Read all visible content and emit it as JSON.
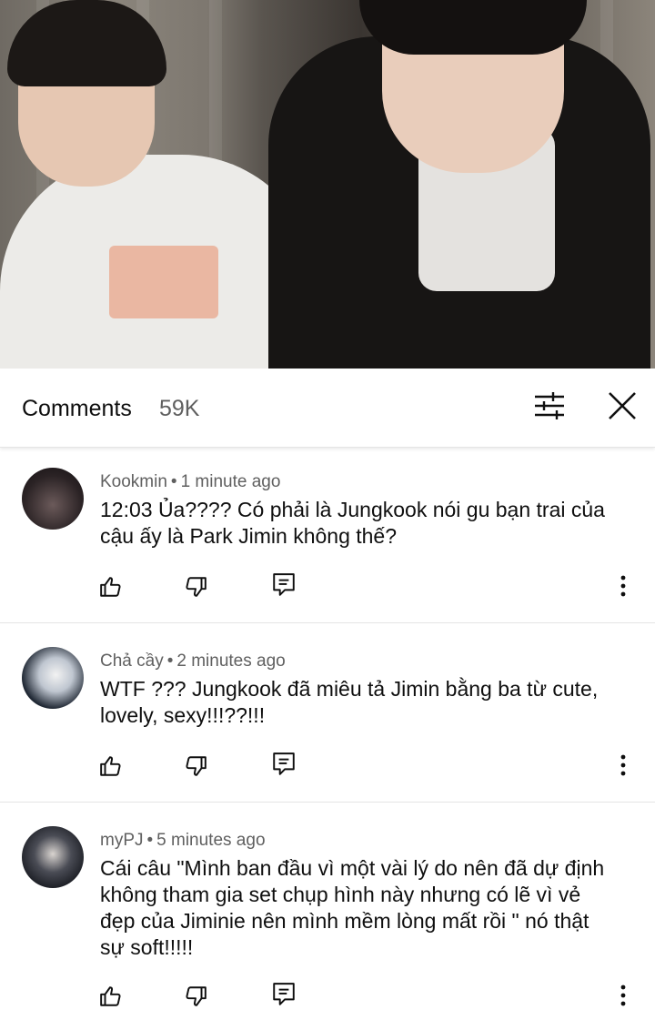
{
  "video": {
    "thumbnail": "video-frame"
  },
  "header": {
    "title": "Comments",
    "count": "59K",
    "filter_icon": "tune-icon",
    "close_icon": "close-icon"
  },
  "comments": [
    {
      "author": "Kookmin",
      "time": "1 minute ago",
      "text_lines": [
        "12:03 Ủa???? Có phải là Jungkook nói gu bạn trai của",
        "cậu ấy là Park Jimin không thế?"
      ]
    },
    {
      "author": "Chả cầy",
      "time": "2 minutes ago",
      "text_lines": [
        "WTF ??? Jungkook đã miêu tả Jimin bằng ba từ cute,",
        "lovely, sexy!!!??!!!"
      ]
    },
    {
      "author": "myPJ",
      "time": "5 minutes ago",
      "text_lines": [
        "Cái câu \"Mình ban đầu vì một vài lý do nên đã dự định",
        "không tham gia set chụp hình này nhưng có lẽ vì vẻ",
        "đẹp của Jiminie nên mình mềm lòng mất rồi \" nó thật",
        "sự soft!!!!!"
      ]
    }
  ],
  "colors": {
    "text": "#0f0f0f",
    "secondary": "#606060",
    "divider": "#e5e5e5"
  }
}
